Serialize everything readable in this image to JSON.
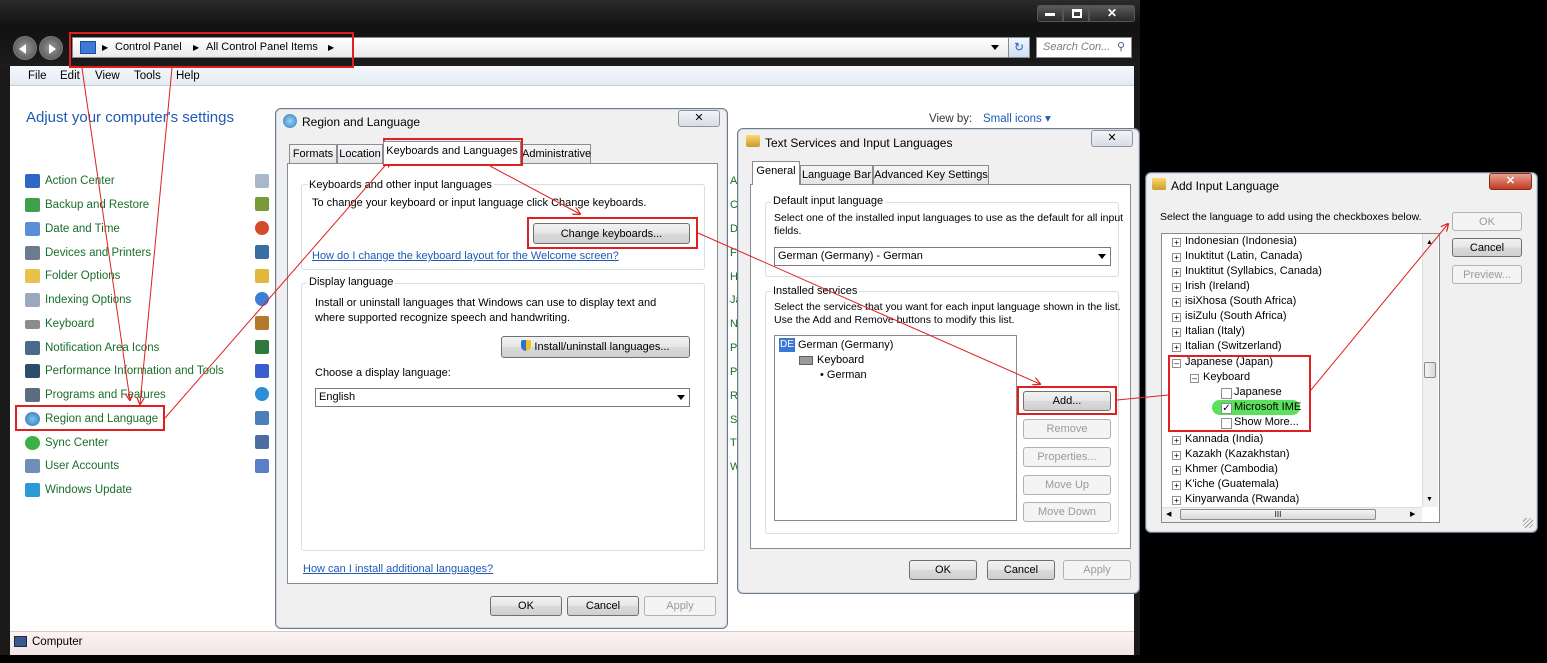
{
  "explorer": {
    "breadcrumb": [
      "Control Panel",
      "All Control Panel Items"
    ],
    "search_placeholder": "Search Con...",
    "menu": [
      "File",
      "Edit",
      "View",
      "Tools",
      "Help"
    ],
    "heading": "Adjust your computer's settings",
    "view_by_label": "View by:",
    "view_by_value": "Small icons",
    "items": [
      "Action Center",
      "Backup and Restore",
      "Date and Time",
      "Devices and Printers",
      "Folder Options",
      "Indexing Options",
      "Keyboard",
      "Notification Area Icons",
      "Performance Information and Tools",
      "Programs and Features",
      "Region and Language",
      "Sync Center",
      "User Accounts",
      "Windows Update"
    ],
    "partial_letters": [
      "A",
      "C",
      "D",
      "F",
      "H",
      "Ja",
      "N",
      "P",
      "P",
      "R",
      "S",
      "T",
      "W"
    ],
    "status": "Computer"
  },
  "region_dialog": {
    "title": "Region and Language",
    "tabs": [
      "Formats",
      "Location",
      "Keyboards and Languages",
      "Administrative"
    ],
    "group1_title": "Keyboards and other input languages",
    "group1_text": "To change your keyboard or input language click Change keyboards.",
    "change_keyboards": "Change keyboards...",
    "welcome_link": "How do I change the keyboard layout for the Welcome screen?",
    "group2_title": "Display language",
    "group2_text_1": "Install or uninstall languages that Windows can use to display text and",
    "group2_text_2": "where supported recognize speech and handwriting.",
    "install_button": "Install/uninstall languages...",
    "choose_label": "Choose a display language:",
    "display_language": "English",
    "install_link": "How can I install additional languages?",
    "ok": "OK",
    "cancel": "Cancel",
    "apply": "Apply"
  },
  "text_services_dialog": {
    "title": "Text Services and Input Languages",
    "tabs": [
      "General",
      "Language Bar",
      "Advanced Key Settings"
    ],
    "default_group_title": "Default input language",
    "default_text_1": "Select one of the installed input languages to use as the default for all input",
    "default_text_2": "fields.",
    "default_value": "German (Germany) - German",
    "installed_group_title": "Installed services",
    "installed_text_1": "Select the services that you want for each input language shown in the list.",
    "installed_text_2": "Use the Add and Remove buttons to modify this list.",
    "tree_badge": "DE",
    "tree_lang": "German (Germany)",
    "tree_keyboard": "Keyboard",
    "tree_layout": "German",
    "add": "Add...",
    "remove": "Remove",
    "properties": "Properties...",
    "move_up": "Move Up",
    "move_down": "Move Down",
    "ok": "OK",
    "cancel": "Cancel",
    "apply": "Apply"
  },
  "add_input_dialog": {
    "title": "Add Input Language",
    "instruction": "Select the language to add using the checkboxes below.",
    "ok": "OK",
    "cancel": "Cancel",
    "preview": "Preview...",
    "languages_before": [
      "Indonesian (Indonesia)",
      "Inuktitut (Latin, Canada)",
      "Inuktitut (Syllabics, Canada)",
      "Irish (Ireland)",
      "isiXhosa (South Africa)",
      "isiZulu (South Africa)",
      "Italian (Italy)",
      "Italian (Switzerland)"
    ],
    "expanded_language": "Japanese (Japan)",
    "keyboard_node": "Keyboard",
    "layouts": [
      {
        "label": "Japanese",
        "checked": false
      },
      {
        "label": "Microsoft IME",
        "checked": true
      },
      {
        "label": "Show More...",
        "checked": false
      }
    ],
    "languages_after": [
      "Kannada (India)",
      "Kazakh (Kazakhstan)",
      "Khmer (Cambodia)",
      "K'iche (Guatemala)",
      "Kinyarwanda (Rwanda)"
    ],
    "scroll_grip": "III"
  },
  "colors": {
    "annotation_red": "#e02020",
    "highlight_green": "#5be05b",
    "link_blue": "#1e5ab6",
    "cp_green": "#1a6e2a"
  }
}
